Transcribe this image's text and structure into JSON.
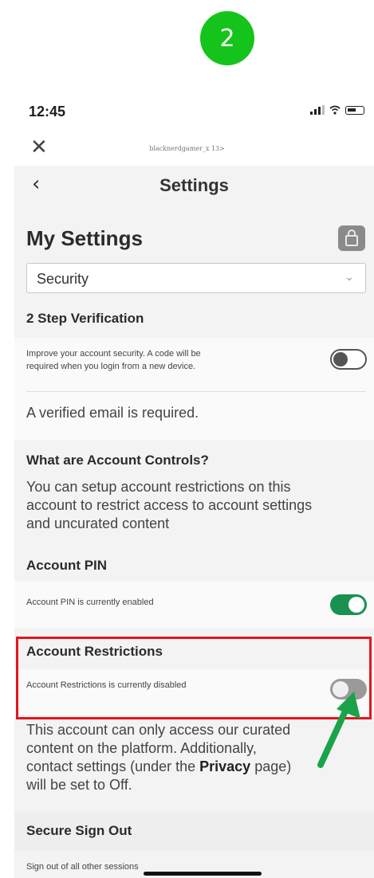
{
  "step_badge": "2",
  "status_bar": {
    "time": "12:45"
  },
  "browser": {
    "url": "blacknerdgamer_x 13>"
  },
  "nav": {
    "title": "Settings"
  },
  "page": {
    "title": "My Settings"
  },
  "section_select": {
    "value": "Security"
  },
  "two_step": {
    "heading": "2 Step Verification",
    "description_line1": "Improve your account security. A code will be",
    "description_line2": "required when you login from a new device.",
    "toggle_on": false,
    "note": "A verified email is required."
  },
  "account_controls": {
    "heading": "What are Account Controls?",
    "line1": "You can setup account restrictions on this",
    "line2": "account to restrict access to account settings",
    "line3": "and uncurated content"
  },
  "account_pin": {
    "heading": "Account PIN",
    "status": "Account PIN is currently enabled",
    "toggle_on": true
  },
  "account_restrictions": {
    "heading": "Account Restrictions",
    "status": "Account Restrictions is currently disabled",
    "toggle_on": false,
    "desc_line1": "This account can only access our curated",
    "desc_line2": "content on the platform. Additionally,",
    "desc_line3_a": "contact settings (under the ",
    "desc_line3_bold": "Privacy",
    "desc_line3_b": " page)",
    "desc_line4": "will be set to Off."
  },
  "secure_sign_out": {
    "heading": "Secure Sign Out",
    "status": "Sign out of all other sessions"
  },
  "colors": {
    "badge": "#15c41a",
    "toggle_on": "#1a9150",
    "highlight_box": "#e3161c",
    "arrow": "#1aa34a"
  },
  "icons": [
    "close-icon",
    "back-chevron-icon",
    "lock-icon",
    "chevron-down-icon",
    "signal-icon",
    "wifi-icon",
    "battery-icon",
    "arrow-pointer-icon"
  ]
}
